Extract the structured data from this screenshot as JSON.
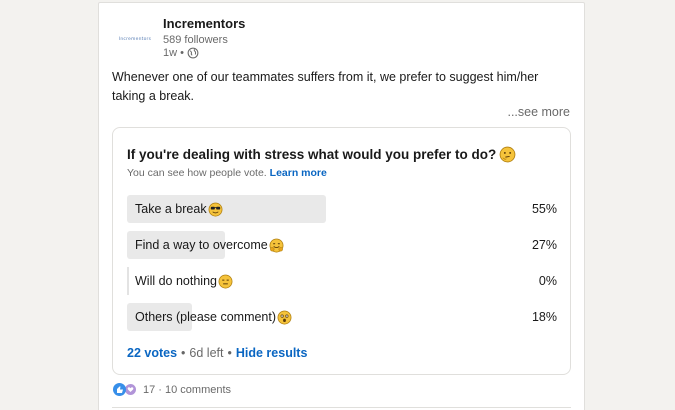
{
  "post": {
    "logo_text": "Incrementors",
    "author_name": "Incrementors",
    "followers": "589 followers",
    "time": "1w",
    "separator": "•",
    "text": "Whenever one of our teammates suffers from it, we prefer to suggest him/her taking a break.",
    "see_more": "...see more"
  },
  "poll": {
    "question": "If you're dealing with stress what would you prefer to do?",
    "note": "You can see how people vote.",
    "learn_more": "Learn more",
    "options": [
      {
        "label": "Take a break",
        "percent": "55%",
        "fraction": 0.55,
        "emoji": "sunglasses-face-icon"
      },
      {
        "label": "Find a way to overcome",
        "percent": "27%",
        "fraction": 0.27,
        "emoji": "hugging-face-icon"
      },
      {
        "label": "Will do nothing",
        "percent": "0%",
        "fraction": 0.0,
        "emoji": "expressionless-face-icon"
      },
      {
        "label": "Others (please comment)",
        "percent": "18%",
        "fraction": 0.18,
        "emoji": "astonished-face-icon"
      }
    ],
    "votes": "22 votes",
    "time_left": "6d left",
    "hide_results": "Hide results",
    "dot": "•"
  },
  "social": {
    "counts": "17 · 10 comments"
  },
  "colors": {
    "accent": "#0a66c2",
    "bar_fill": "#e9e9e9",
    "like": "#378fe9",
    "support": "#b194d8"
  }
}
